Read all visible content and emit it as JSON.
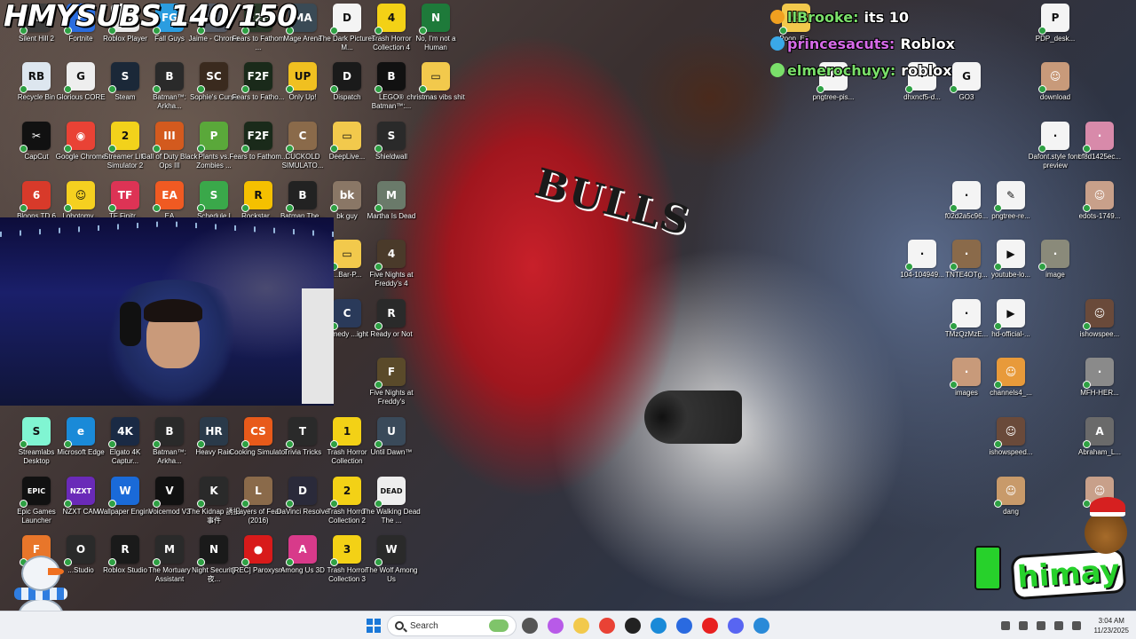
{
  "overlay": {
    "subs_title": "HMYSUBS 140/150"
  },
  "desktop_icons": [
    {
      "label": "Silent Hill 2",
      "color": "#3d3d3d",
      "glyph": "SH"
    },
    {
      "label": "Fortnite",
      "color": "#2a6de0",
      "glyph": "F"
    },
    {
      "label": "Roblox Player",
      "color": "#e8e8e8",
      "glyph": "R"
    },
    {
      "label": "Fall Guys",
      "color": "#2b9de0",
      "glyph": "FG"
    },
    {
      "label": "Jaime - Chrome",
      "color": "#555b66",
      "glyph": "J"
    },
    {
      "label": "Fears to Fathom ...",
      "color": "#2a3a2a",
      "glyph": "F2F"
    },
    {
      "label": "Mage Arena",
      "color": "#3a4a55",
      "glyph": "MA"
    },
    {
      "label": "The Dark Pictures M...",
      "color": "#f4f4f4",
      "glyph": "D"
    },
    {
      "label": "Trash Horror Collection 4",
      "color": "#f3d116",
      "glyph": "4"
    },
    {
      "label": "No, I'm not a Human",
      "color": "#1e7a3a",
      "glyph": "N"
    },
    {
      "label": "Recycle Bin",
      "color": "#dde6ef",
      "glyph": "RB"
    },
    {
      "label": "Glorious CORE",
      "color": "#eeeeee",
      "glyph": "G"
    },
    {
      "label": "Steam",
      "color": "#1b2838",
      "glyph": "S"
    },
    {
      "label": "Batman™: Arkha...",
      "color": "#2a2a2a",
      "glyph": "B"
    },
    {
      "label": "Sophie's Curse",
      "color": "#3a2a1e",
      "glyph": "SC"
    },
    {
      "label": "Fears to Fatho...",
      "color": "#1a2a1a",
      "glyph": "F2F"
    },
    {
      "label": "Only Up!",
      "color": "#f0c020",
      "glyph": "UP"
    },
    {
      "label": "Dispatch",
      "color": "#1a1a1a",
      "glyph": "D"
    },
    {
      "label": "LEGO® Batman™:...",
      "color": "#111111",
      "glyph": "B"
    },
    {
      "label": "christmas vibs shit",
      "color": "#f2c94c",
      "glyph": "▭"
    },
    {
      "label": "CapCut",
      "color": "#111111",
      "glyph": "✂"
    },
    {
      "label": "Google Chrome",
      "color": "#e94235",
      "glyph": "◉"
    },
    {
      "label": "Streamer Life Simulator 2",
      "color": "#f2d21b",
      "glyph": "2"
    },
    {
      "label": "Call of Duty Black Ops III",
      "color": "#d35a1e",
      "glyph": "III"
    },
    {
      "label": "Plants vs. Zombies ...",
      "color": "#5aa83a",
      "glyph": "P"
    },
    {
      "label": "Fears to Fathom...",
      "color": "#1a2a1a",
      "glyph": "F2F"
    },
    {
      "label": "CUCKOLD SIMULATO...",
      "color": "#8a6a4a",
      "glyph": "C"
    },
    {
      "label": "DeepLive...",
      "color": "#f2c94c",
      "glyph": "▭"
    },
    {
      "label": "Shieldwall",
      "color": "#2a2a2a",
      "glyph": "S"
    },
    {
      "label": "Bloons TD 6",
      "color": "#d83a2a",
      "glyph": "6"
    },
    {
      "label": "Lobotomy...",
      "color": "#f5d020",
      "glyph": "☺"
    },
    {
      "label": "TF Finitr...",
      "color": "#dd3355",
      "glyph": "TF"
    },
    {
      "label": "EA",
      "color": "#f05a22",
      "glyph": "EA"
    },
    {
      "label": "Schedule I",
      "color": "#3aa84a",
      "glyph": "S"
    },
    {
      "label": "Rockstar...",
      "color": "#f5c000",
      "glyph": "R"
    },
    {
      "label": "Batman The...",
      "color": "#222222",
      "glyph": "B"
    },
    {
      "label": "bk guy",
      "color": "#8a7766",
      "glyph": "bk"
    },
    {
      "label": "Martha Is Dead",
      "color": "#6a7a6a",
      "glyph": "M"
    },
    {
      "label": "...Bar-P...",
      "color": "#f2c94c",
      "glyph": "▭"
    },
    {
      "label": "Five Nights at Freddy's 4",
      "color": "#4a3a2a",
      "glyph": "4"
    },
    {
      "label": "...medy ...ight",
      "color": "#2a3a5a",
      "glyph": "C"
    },
    {
      "label": "Ready or Not",
      "color": "#2a2a2a",
      "glyph": "R"
    },
    {
      "label": "Five Nights at Freddy's",
      "color": "#5a4a2a",
      "glyph": "F"
    },
    {
      "label": "Streamlabs Desktop",
      "color": "#80f5d2",
      "glyph": "S"
    },
    {
      "label": "Microsoft Edge",
      "color": "#1a8ad8",
      "glyph": "e"
    },
    {
      "label": "Elgato 4K Captur...",
      "color": "#1a2a44",
      "glyph": "4K"
    },
    {
      "label": "Batman™: Arkha...",
      "color": "#2a2a2a",
      "glyph": "B"
    },
    {
      "label": "Heavy Rain",
      "color": "#2a3a4a",
      "glyph": "HR"
    },
    {
      "label": "Cooking Simulator",
      "color": "#e85a1a",
      "glyph": "CS"
    },
    {
      "label": "Trivia Tricks",
      "color": "#2a2a2a",
      "glyph": "T"
    },
    {
      "label": "Trash Horror Collection",
      "color": "#f3d116",
      "glyph": "1"
    },
    {
      "label": "Until Dawn™",
      "color": "#3a4a5a",
      "glyph": "U"
    },
    {
      "label": "Epic Games Launcher",
      "color": "#111111",
      "glyph": "EPIC"
    },
    {
      "label": "NZXT CAM",
      "color": "#6a2ab8",
      "glyph": "NZXT"
    },
    {
      "label": "Wallpaper Engine",
      "color": "#1a6ad8",
      "glyph": "W"
    },
    {
      "label": "Voicemod V3",
      "color": "#111111",
      "glyph": "V"
    },
    {
      "label": "The Kidnap 誘拐事件",
      "color": "#2a2a2a",
      "glyph": "K"
    },
    {
      "label": "Layers of Fear (2016)",
      "color": "#8a6a4a",
      "glyph": "L"
    },
    {
      "label": "DaVinci Resolve",
      "color": "#2a2a3a",
      "glyph": "D"
    },
    {
      "label": "Trash Horror Collection 2",
      "color": "#f3d116",
      "glyph": "2"
    },
    {
      "label": "The Walking Dead The ...",
      "color": "#eeeeee",
      "glyph": "DEAD"
    },
    {
      "label": "F...",
      "color": "#e8762a",
      "glyph": "F"
    },
    {
      "label": "...Studio",
      "color": "#2a2a2a",
      "glyph": "O"
    },
    {
      "label": "Roblox Studio",
      "color": "#1a1a1a",
      "glyph": "R"
    },
    {
      "label": "The Mortuary Assistant",
      "color": "#2a2a2a",
      "glyph": "M"
    },
    {
      "label": "Night Security 夜...",
      "color": "#1a1a1a",
      "glyph": "N"
    },
    {
      "label": "[REC] Paroxysm",
      "color": "#d81a1a",
      "glyph": "●"
    },
    {
      "label": "Among Us 3D",
      "color": "#d83a8a",
      "glyph": "A"
    },
    {
      "label": "Trash Horror Collection 3",
      "color": "#f3d116",
      "glyph": "3"
    },
    {
      "label": "The Wolf Among Us",
      "color": "#2a2a2a",
      "glyph": "W"
    },
    {
      "label": "PDP_desk...",
      "color": "#f4f4f4",
      "glyph": "P"
    },
    {
      "label": "Poop_Er...",
      "color": "#f2c94c",
      "glyph": "▭"
    },
    {
      "label": "pngtree-pis...",
      "color": "#f4f4f4",
      "glyph": "·"
    },
    {
      "label": "dhxncf5-d...",
      "color": "#f4f4f4",
      "glyph": "·"
    },
    {
      "label": "GO3",
      "color": "#f4f4f4",
      "glyph": "G"
    },
    {
      "label": "download",
      "color": "#c89a7a",
      "glyph": "☺"
    },
    {
      "label": "Dafont.style font-preview",
      "color": "#f4f4f4",
      "glyph": "·"
    },
    {
      "label": "cf8d1425ec...",
      "color": "#d88aaa",
      "glyph": "·"
    },
    {
      "label": "f02d2a5c96...",
      "color": "#f4f4f4",
      "glyph": "·"
    },
    {
      "label": "pngtree-re...",
      "color": "#f4f4f4",
      "glyph": "✎"
    },
    {
      "label": "edots-1749...",
      "color": "#c8a08a",
      "glyph": "☺"
    },
    {
      "label": "104-104949...",
      "color": "#f4f4f4",
      "glyph": "·"
    },
    {
      "label": "TNTE4OTg...",
      "color": "#8a6a4a",
      "glyph": "·"
    },
    {
      "label": "youtube-lo...",
      "color": "#f4f4f4",
      "glyph": "▶"
    },
    {
      "label": "image",
      "color": "#8a8a7a",
      "glyph": "·"
    },
    {
      "label": "TMzQzMzE...",
      "color": "#f4f4f4",
      "glyph": "·"
    },
    {
      "label": "hd-official-...",
      "color": "#f4f4f4",
      "glyph": "▶"
    },
    {
      "label": "ishowspee...",
      "color": "#6a4a3a",
      "glyph": "☺"
    },
    {
      "label": "images",
      "color": "#c89a7a",
      "glyph": "·"
    },
    {
      "label": "channels4_...",
      "color": "#e89a3a",
      "glyph": "☺"
    },
    {
      "label": "MFH-HER...",
      "color": "#8a8a8a",
      "glyph": "·"
    },
    {
      "label": "ishowspeed...",
      "color": "#6a4a3a",
      "glyph": "☺"
    },
    {
      "label": "Abraham_L...",
      "color": "#6a6a6a",
      "glyph": "A"
    },
    {
      "label": "dang",
      "color": "#c89a6a",
      "glyph": "☺"
    },
    {
      "label": "...",
      "color": "#c8a08a",
      "glyph": "☺"
    }
  ],
  "chat": {
    "messages": [
      {
        "user": "llBrooke:",
        "user_color": "#7adf6a",
        "text": "its 10",
        "badge_color": "#f0a020"
      },
      {
        "user": "princesacuts:",
        "user_color": "#d66ae8",
        "text": "Roblox",
        "badge_color": "#3aa8e8"
      },
      {
        "user": "elmerochuyy:",
        "user_color": "#7adf6a",
        "text": "roblox",
        "badge_color": "#7adf6a"
      }
    ]
  },
  "branding": {
    "logo_text": "himay"
  },
  "taskbar": {
    "search_placeholder": "Search",
    "time": "3:04 AM",
    "date": "11/23/2025",
    "pinned": [
      {
        "name": "task-view",
        "color": "#555"
      },
      {
        "name": "copilot",
        "color": "#b85ae8"
      },
      {
        "name": "file-explorer",
        "color": "#f2c94c"
      },
      {
        "name": "chrome",
        "color": "#e94235"
      },
      {
        "name": "obs",
        "color": "#222"
      },
      {
        "name": "edge",
        "color": "#1a8ad8"
      },
      {
        "name": "store",
        "color": "#2a6ae0"
      },
      {
        "name": "youtube",
        "color": "#e82020"
      },
      {
        "name": "discord",
        "color": "#5865f2"
      },
      {
        "name": "security",
        "color": "#2a8ad8"
      }
    ]
  }
}
